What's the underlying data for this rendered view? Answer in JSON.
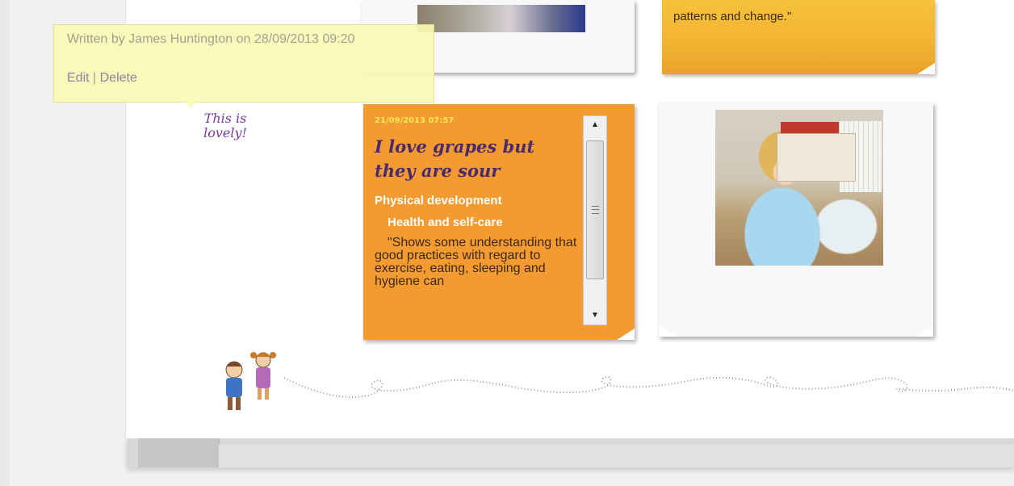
{
  "tooltip": {
    "author_line": "Written by James Huntington on 28/09/2013 09:20",
    "edit_label": "Edit",
    "separator": " | ",
    "delete_label": "Delete"
  },
  "comment": {
    "text": "This is lovely!"
  },
  "yellow_note": {
    "text": "patterns and change.\""
  },
  "orange_note": {
    "date": "21/09/2013 07:57",
    "title": "I love grapes but they are sour",
    "category": "Physical development",
    "subcategory": "Health and self-care",
    "body": "\"Shows some understanding that good practices with regard to exercise, eating, sleeping and hygiene can"
  },
  "colors": {
    "orange_note": "#f39a30",
    "yellow_note": "#f7c23b",
    "tooltip_bg": "#fafab5",
    "comment_text": "#7a3a9a"
  },
  "icons": {
    "scroll_up": "triangle-up",
    "scroll_down": "triangle-down",
    "scroll_grip": "grip-lines"
  }
}
